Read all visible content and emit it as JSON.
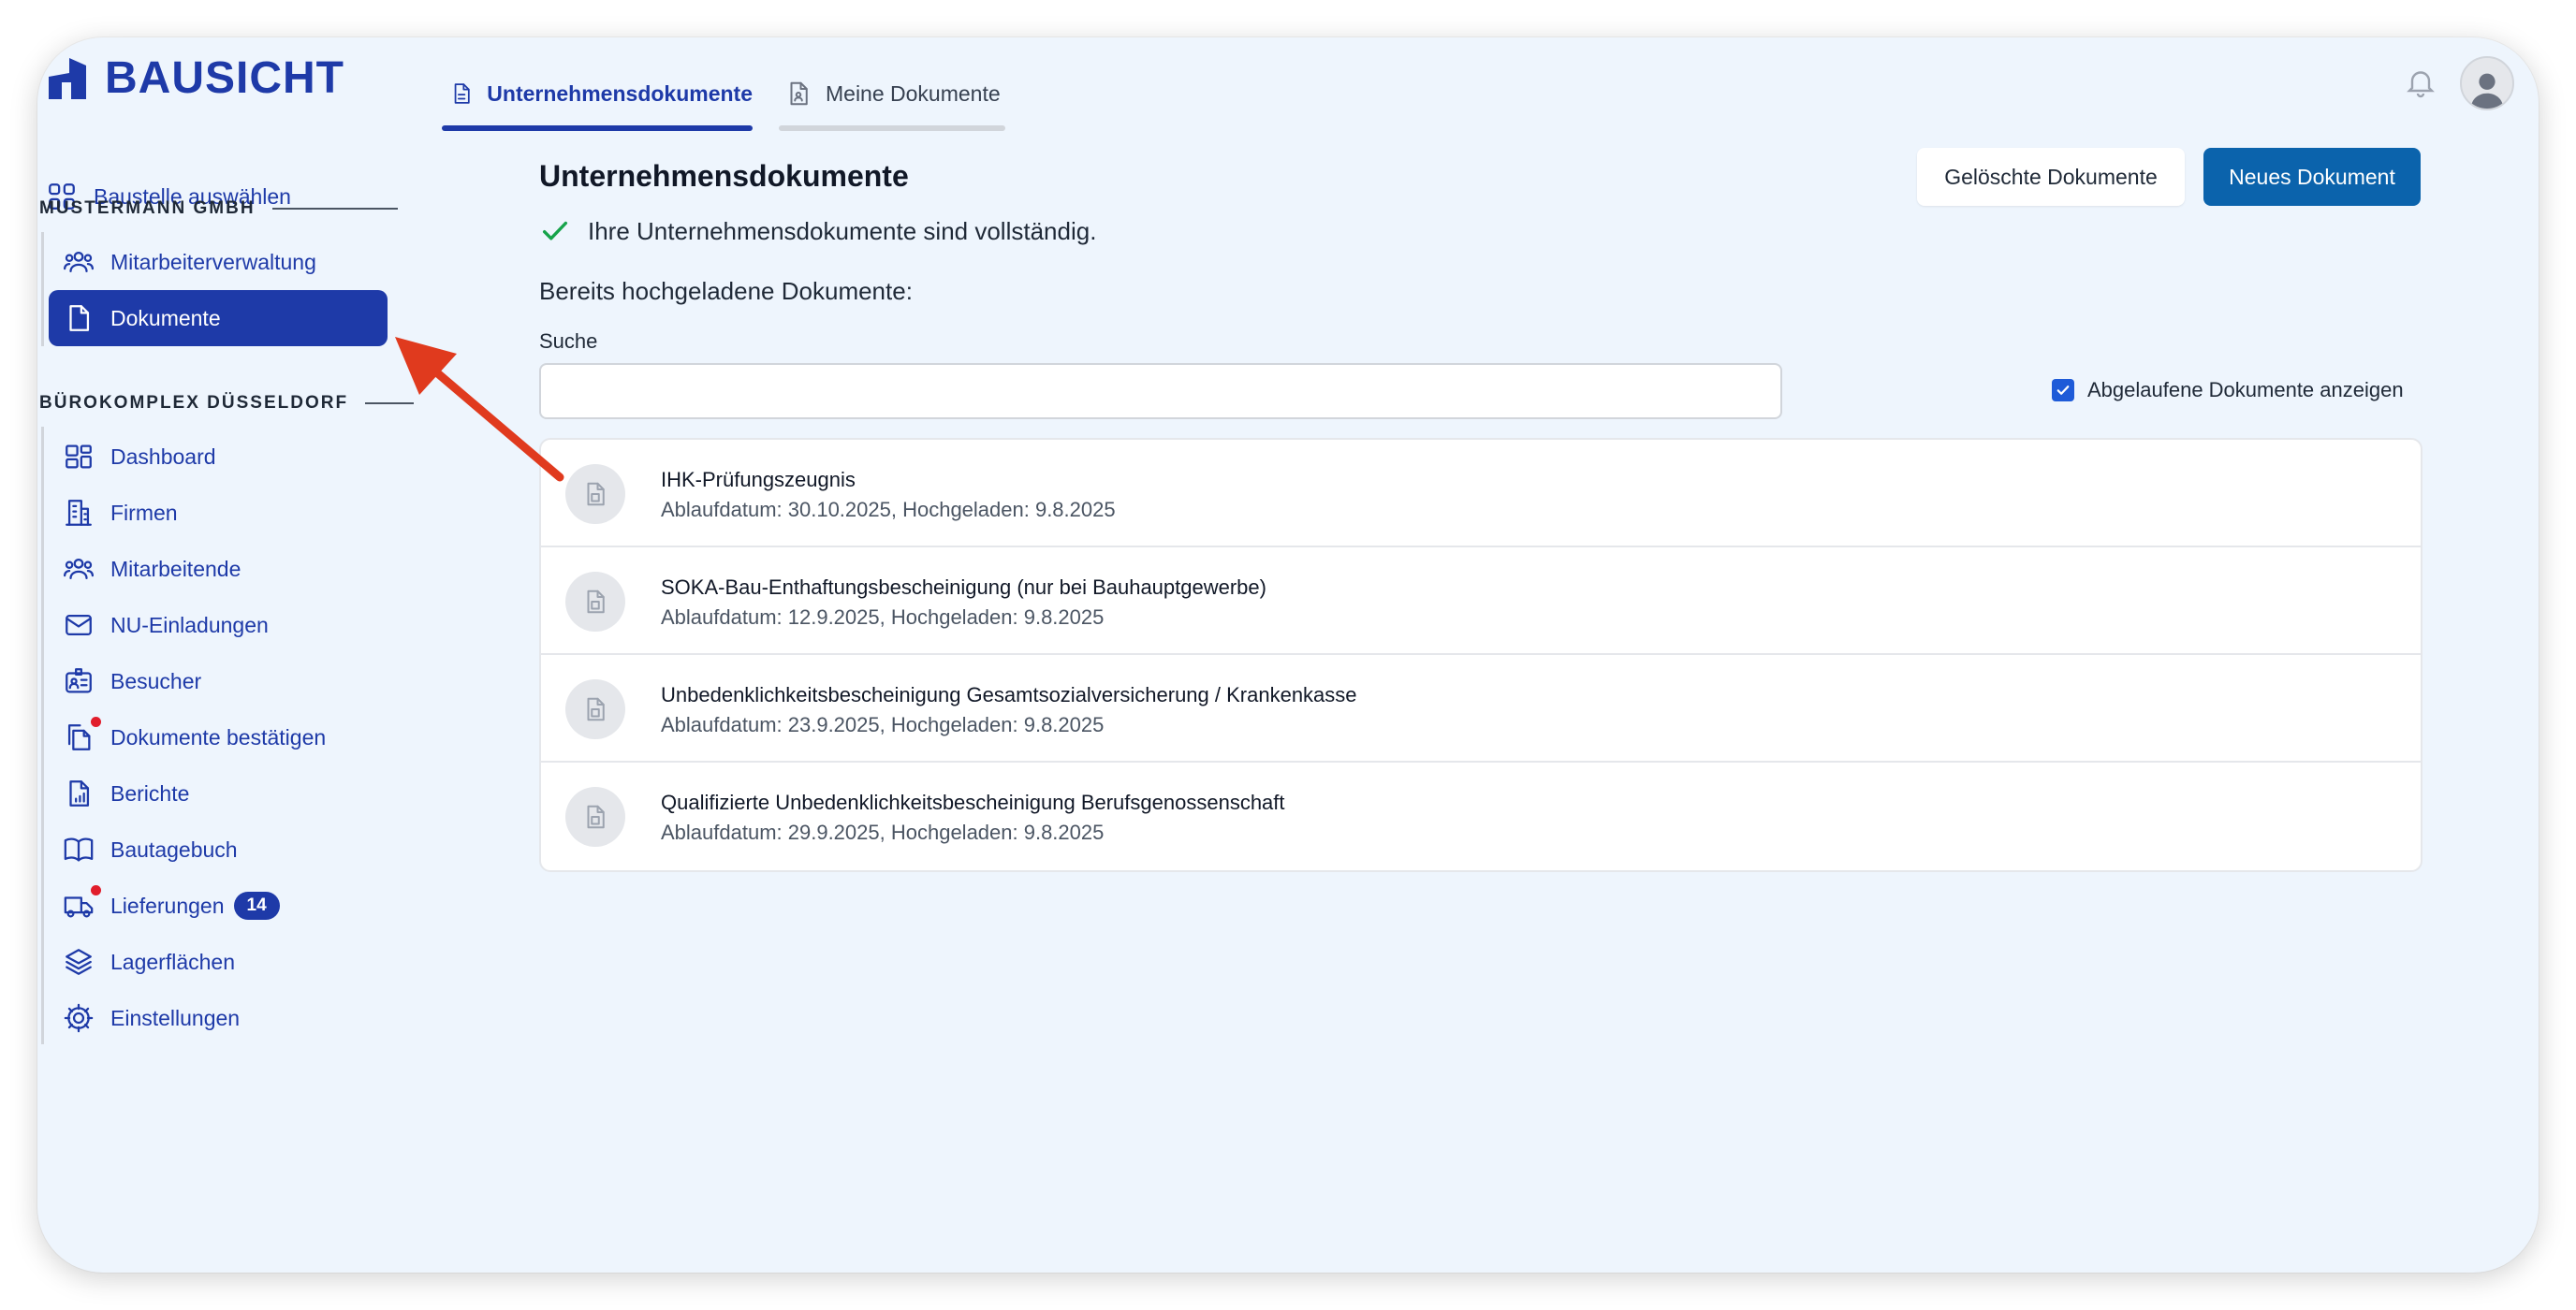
{
  "app": {
    "logo_text": "BAUSICHT"
  },
  "sidebar": {
    "select_site": "Baustelle auswählen",
    "section1": "MUSTERMANN GMBH",
    "section1_items": [
      {
        "label": "Mitarbeiterverwaltung",
        "icon": "users-icon"
      },
      {
        "label": "Dokumente",
        "icon": "document-icon",
        "active": true
      }
    ],
    "section2": "BÜROKOMPLEX DÜSSELDORF",
    "section2_items": [
      {
        "label": "Dashboard",
        "icon": "dashboard-icon"
      },
      {
        "label": "Firmen",
        "icon": "building-icon"
      },
      {
        "label": "Mitarbeitende",
        "icon": "users-icon"
      },
      {
        "label": "NU-Einladungen",
        "icon": "envelope-icon"
      },
      {
        "label": "Besucher",
        "icon": "id-card-icon"
      },
      {
        "label": "Dokumente bestätigen",
        "icon": "documents-icon",
        "notification": true
      },
      {
        "label": "Berichte",
        "icon": "report-icon"
      },
      {
        "label": "Bautagebuch",
        "icon": "book-icon"
      },
      {
        "label": "Lieferungen",
        "icon": "truck-icon",
        "notification": true,
        "badge": "14"
      },
      {
        "label": "Lagerflächen",
        "icon": "layers-icon"
      },
      {
        "label": "Einstellungen",
        "icon": "gear-icon"
      }
    ]
  },
  "tabs": [
    {
      "label": "Unternehmensdokumente",
      "active": true
    },
    {
      "label": "Meine Dokumente",
      "active": false
    }
  ],
  "main": {
    "title": "Unternehmensdokumente",
    "deleted_docs_button": "Gelöschte Dokumente",
    "new_doc_button": "Neues Dokument",
    "status": "Ihre Unternehmensdokumente sind vollständig.",
    "uploaded_heading": "Bereits hochgeladene Dokumente:",
    "search_label": "Suche",
    "search_value": "",
    "show_expired_label": "Abgelaufene Dokumente anzeigen",
    "show_expired_checked": true,
    "documents": [
      {
        "name": "IHK-Prüfungszeugnis",
        "meta": "Ablaufdatum: 30.10.2025, Hochgeladen: 9.8.2025"
      },
      {
        "name": "SOKA-Bau-Enthaftungsbescheinigung (nur bei Bauhauptgewerbe)",
        "meta": "Ablaufdatum: 12.9.2025, Hochgeladen: 9.8.2025"
      },
      {
        "name": "Unbedenklichkeitsbescheinigung Gesamtsozialversicherung / Krankenkasse",
        "meta": "Ablaufdatum: 23.9.2025, Hochgeladen: 9.8.2025"
      },
      {
        "name": "Qualifizierte Unbedenklichkeitsbescheinigung Berufsgenossenschaft",
        "meta": "Ablaufdatum: 29.9.2025, Hochgeladen: 9.8.2025"
      }
    ]
  },
  "colors": {
    "brand": "#1e3aa8",
    "primary_button": "#0b63ac",
    "success": "#16a34a",
    "notification": "#e11d2b",
    "annotation_arrow": "#e03a1e"
  }
}
